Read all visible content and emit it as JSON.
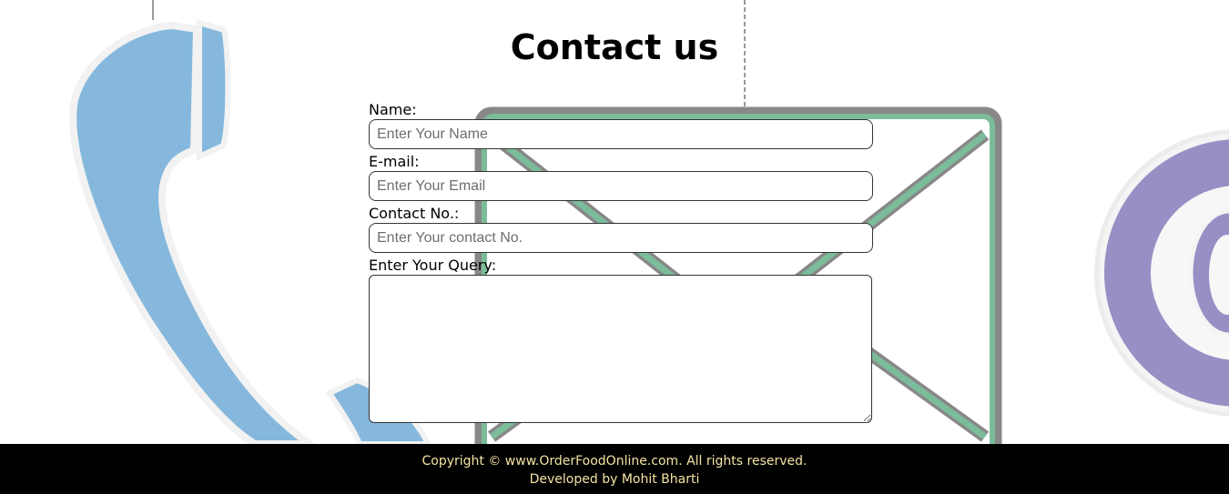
{
  "page": {
    "title": "Contact us"
  },
  "form": {
    "name_label": "Name:",
    "name_placeholder": "Enter Your Name",
    "email_label": "E-mail:",
    "email_placeholder": "Enter Your Email",
    "contact_label": "Contact No.:",
    "contact_placeholder": "Enter Your contact No.",
    "query_label": "Enter Your Query:"
  },
  "footer": {
    "copyright": "Copyright © www.OrderFoodOnline.com. All rights reserved.",
    "developer": "Developed by Mohit Bharti"
  },
  "colors": {
    "phone": "#85b8dc",
    "envelope_stroke": "#7bbd9b",
    "envelope_border": "#888888",
    "at_sign": "#9690c5",
    "footer_bg": "#000000",
    "footer_text": "#f3e3a3"
  }
}
